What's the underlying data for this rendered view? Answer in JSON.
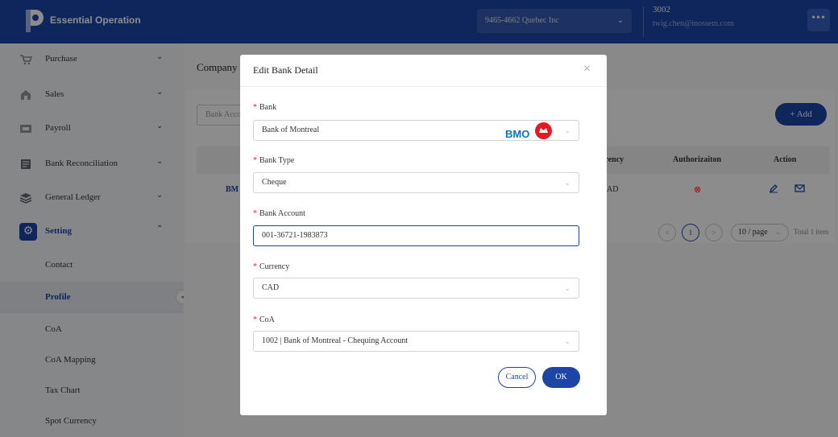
{
  "header": {
    "app_title": "Essential Operation",
    "company": "9465-4662 Quebec Inc",
    "user_id": "3002",
    "user_email": "twig.chen@inossem.com",
    "more_label": "•••"
  },
  "sidebar": {
    "items": [
      {
        "label": "Purchase",
        "icon": "cart-icon"
      },
      {
        "label": "Sales",
        "icon": "shop-icon"
      },
      {
        "label": "Payroll",
        "icon": "payroll-icon"
      },
      {
        "label": "Bank Reconciliation",
        "icon": "document-icon"
      },
      {
        "label": "General Ledger",
        "icon": "layers-icon"
      },
      {
        "label": "Setting",
        "icon": "gear-icon"
      }
    ],
    "sub_items": [
      "Contact",
      "Profile",
      "CoA",
      "CoA Mapping",
      "Tax Chart",
      "Spot Currency"
    ],
    "active_sub": "Profile"
  },
  "main": {
    "page_title": "Company I",
    "search_placeholder": "Bank Acco",
    "add_label": "+ Add",
    "columns": [
      "rrency",
      "Authorizaiton",
      "Action"
    ],
    "row": {
      "bank": "BM",
      "currency": "AD"
    },
    "pager": {
      "prev": "<",
      "current": "1",
      "next": ">",
      "page_size": "10 / page",
      "total": "Total 1 item"
    }
  },
  "modal": {
    "title": "Edit Bank Detail",
    "close": "×",
    "fields": {
      "bank": {
        "label": "Bank",
        "value": "Bank of Montreal",
        "logo_text": "BMO"
      },
      "bank_type": {
        "label": "Bank Type",
        "value": "Cheque"
      },
      "bank_account": {
        "label": "Bank Account",
        "value": "001-36721-1983873"
      },
      "currency": {
        "label": "Currency",
        "value": "CAD"
      },
      "coa": {
        "label": "CoA",
        "value": "1002 | Bank of Montreal - Chequing Account"
      }
    },
    "cancel_label": "Cancel",
    "ok_label": "OK",
    "required_mark": "*"
  },
  "colors": {
    "brand": "#1d45a8",
    "required": "#f5222d",
    "bmo_blue": "#0079c1",
    "bmo_red": "#e31b23"
  }
}
